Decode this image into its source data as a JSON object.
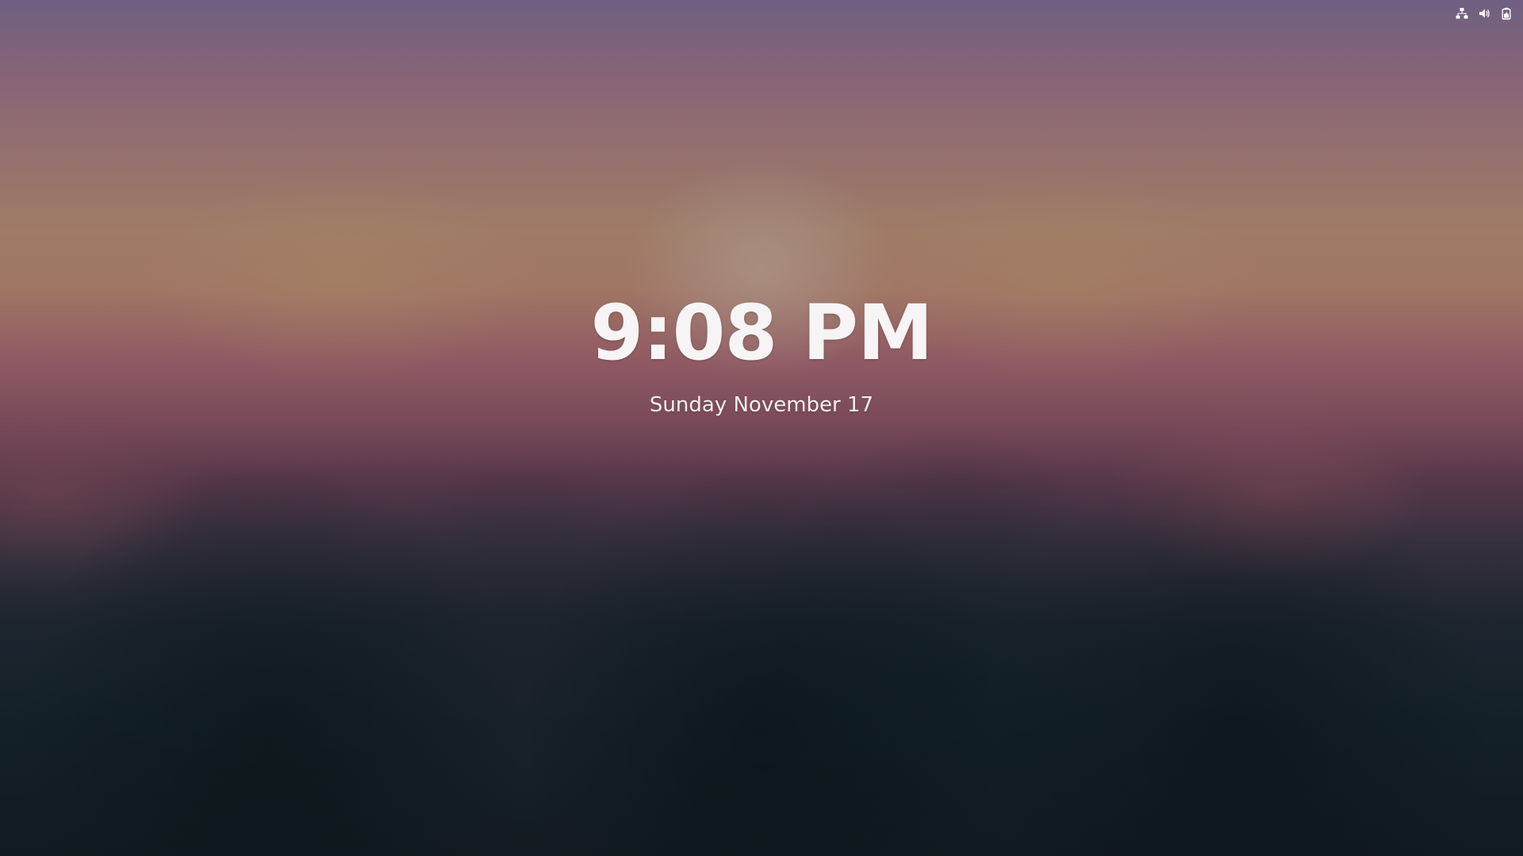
{
  "screen": {
    "kind": "lock-screen",
    "time": "9:08 PM",
    "date": "Sunday November 17"
  },
  "status_bar": {
    "icons": [
      "network-wired-icon",
      "volume-icon",
      "battery-icon"
    ],
    "icon_color": "#ffffff"
  },
  "colors": {
    "text": "#f6f4f4",
    "sky_top": "#6e6080",
    "sky_mid": "#a07564",
    "horizon": "#905a64",
    "ground": "#121c22"
  }
}
